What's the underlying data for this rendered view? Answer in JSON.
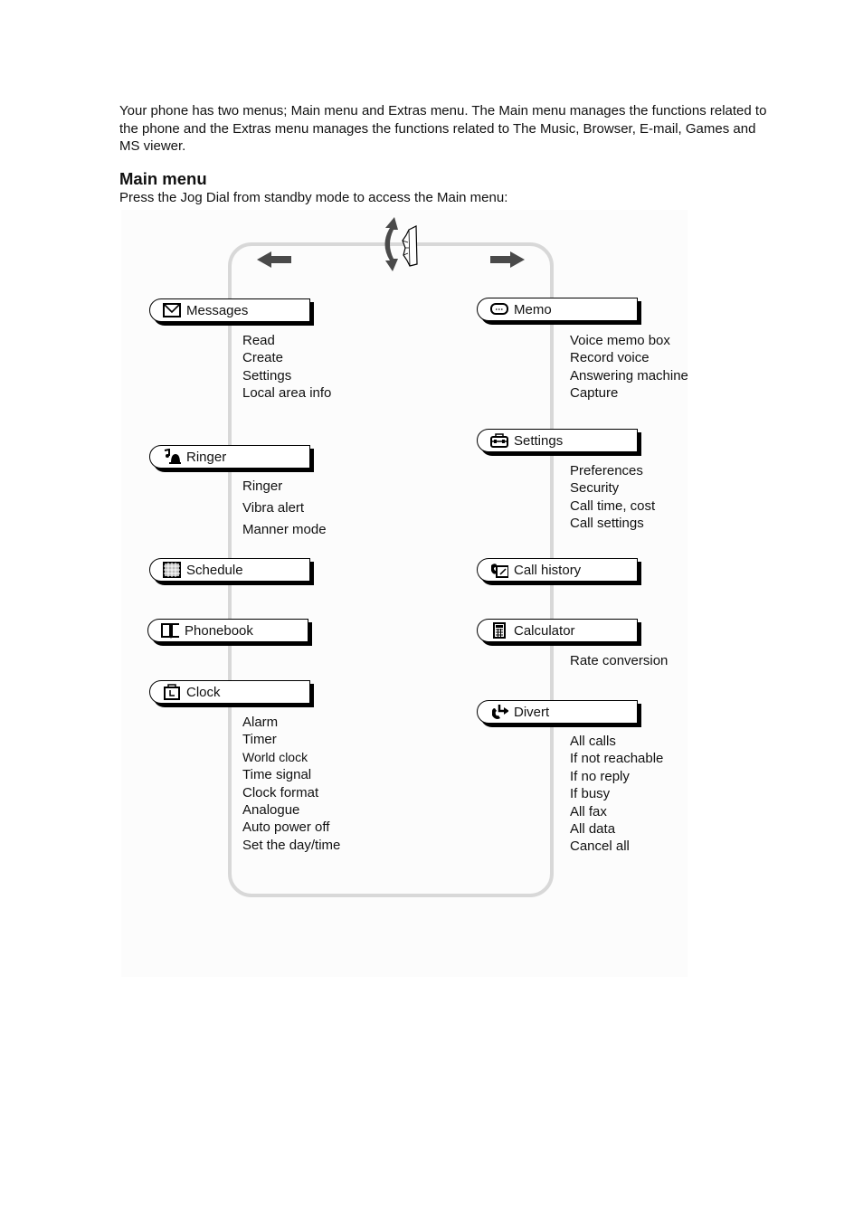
{
  "intro": "Your phone has two menus; Main menu and Extras menu. The Main menu manages the functions related to the phone and the Extras menu manages the functions related to The Music, Browser, E-mail, Games and MS viewer.",
  "heading": "Main menu",
  "subheading": "Press the Jog Dial from standby mode to access the Main menu:",
  "left_menus": [
    {
      "label": "Messages",
      "icon": "envelope-icon",
      "items": [
        "Read",
        "Create",
        "Settings",
        "Local area info"
      ]
    },
    {
      "label": "Ringer",
      "icon": "bell-music-icon",
      "items": [
        "Ringer",
        "Vibra alert",
        "Manner mode"
      ]
    },
    {
      "label": "Schedule",
      "icon": "calendar-icon",
      "items": []
    },
    {
      "label": "Phonebook",
      "icon": "book-icon",
      "items": []
    },
    {
      "label": "Clock",
      "icon": "clock-icon",
      "items": [
        "Alarm",
        "Timer",
        "World clock",
        "Time signal",
        "Clock format",
        "Analogue",
        "Auto power off",
        "Set the day/time"
      ]
    }
  ],
  "right_menus": [
    {
      "label": "Memo",
      "icon": "speech-bubble-icon",
      "items": [
        "Voice memo box",
        "Record voice",
        "Answering machine",
        "Capture"
      ]
    },
    {
      "label": "Settings",
      "icon": "toolbox-icon",
      "items": [
        "Preferences",
        "Security",
        "Call time, cost",
        "Call settings"
      ]
    },
    {
      "label": "Call history",
      "icon": "phone-note-icon",
      "items": []
    },
    {
      "label": "Calculator",
      "icon": "calculator-icon",
      "items": [
        "Rate conversion"
      ]
    },
    {
      "label": "Divert",
      "icon": "divert-phone-icon",
      "items": [
        "All calls",
        "If not reachable",
        "If no reply",
        "If busy",
        "All fax",
        "All data",
        "Cancel all"
      ]
    }
  ],
  "colors": {
    "loop": "#d8d8d8",
    "arrow": "#4a4a4a"
  }
}
